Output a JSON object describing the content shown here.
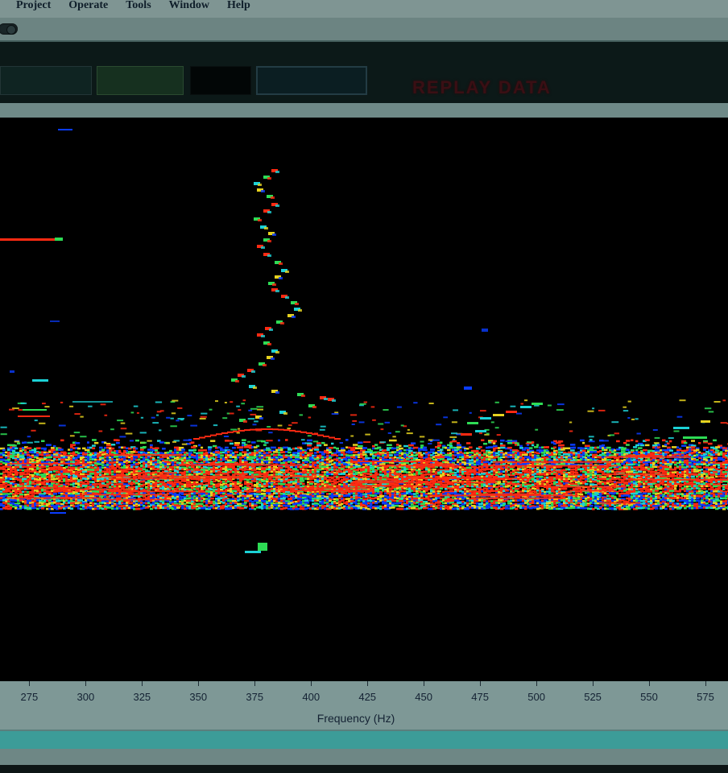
{
  "menu": {
    "items": [
      "Project",
      "Operate",
      "Tools",
      "Window",
      "Help"
    ]
  },
  "controls": {
    "replay_label": "REPLAY DATA"
  },
  "chart_data": {
    "type": "heatmap",
    "title": "",
    "xlabel": "Frequency (Hz)",
    "ylabel": "",
    "x_ticks": [
      275,
      300,
      325,
      350,
      375,
      400,
      425,
      450,
      475,
      500,
      525,
      550,
      575
    ],
    "xlim": [
      262,
      585
    ],
    "colormap": [
      "#0a3cff",
      "#1cd1d6",
      "#2edc55",
      "#e6d21f",
      "#ff2a12"
    ],
    "grid": false,
    "legend": "none"
  }
}
